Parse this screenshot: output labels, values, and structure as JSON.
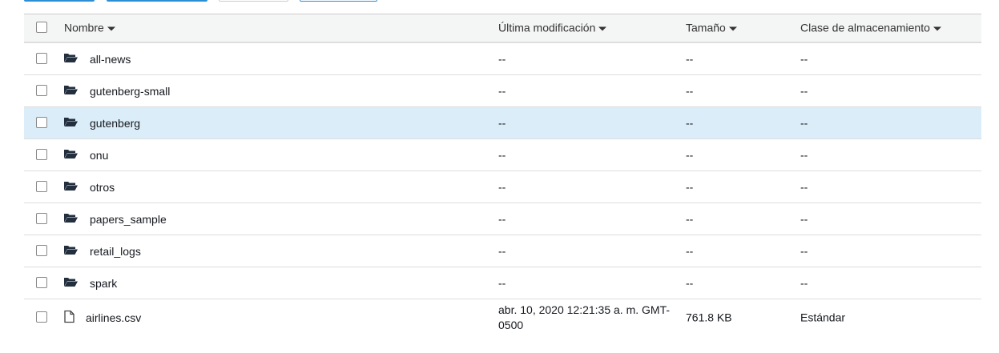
{
  "colors": {
    "accent": "#2c8fd6",
    "selected_row": "#dbedf8",
    "header_bg": "#f4f5f5"
  },
  "columns": {
    "name": "Nombre",
    "modified": "Última modificación",
    "size": "Tamaño",
    "storage_class": "Clase de almacenamiento"
  },
  "rows": [
    {
      "type": "folder",
      "icon": "folder-open-icon",
      "name": "all-news",
      "modified": "--",
      "size": "--",
      "storage_class": "--",
      "selected": false
    },
    {
      "type": "folder",
      "icon": "folder-open-icon",
      "name": "gutenberg-small",
      "modified": "--",
      "size": "--",
      "storage_class": "--",
      "selected": false
    },
    {
      "type": "folder",
      "icon": "folder-open-icon",
      "name": "gutenberg",
      "modified": "--",
      "size": "--",
      "storage_class": "--",
      "selected": true
    },
    {
      "type": "folder",
      "icon": "folder-open-icon",
      "name": "onu",
      "modified": "--",
      "size": "--",
      "storage_class": "--",
      "selected": false
    },
    {
      "type": "folder",
      "icon": "folder-open-icon",
      "name": "otros",
      "modified": "--",
      "size": "--",
      "storage_class": "--",
      "selected": false
    },
    {
      "type": "folder",
      "icon": "folder-open-icon",
      "name": "papers_sample",
      "modified": "--",
      "size": "--",
      "storage_class": "--",
      "selected": false
    },
    {
      "type": "folder",
      "icon": "folder-open-icon",
      "name": "retail_logs",
      "modified": "--",
      "size": "--",
      "storage_class": "--",
      "selected": false
    },
    {
      "type": "folder",
      "icon": "folder-open-icon",
      "name": "spark",
      "modified": "--",
      "size": "--",
      "storage_class": "--",
      "selected": false
    },
    {
      "type": "file",
      "icon": "file-icon",
      "name": "airlines.csv",
      "modified": "abr. 10, 2020 12:21:35 a. m. GMT-0500",
      "size": "761.8 KB",
      "storage_class": "Estándar",
      "selected": false
    }
  ]
}
